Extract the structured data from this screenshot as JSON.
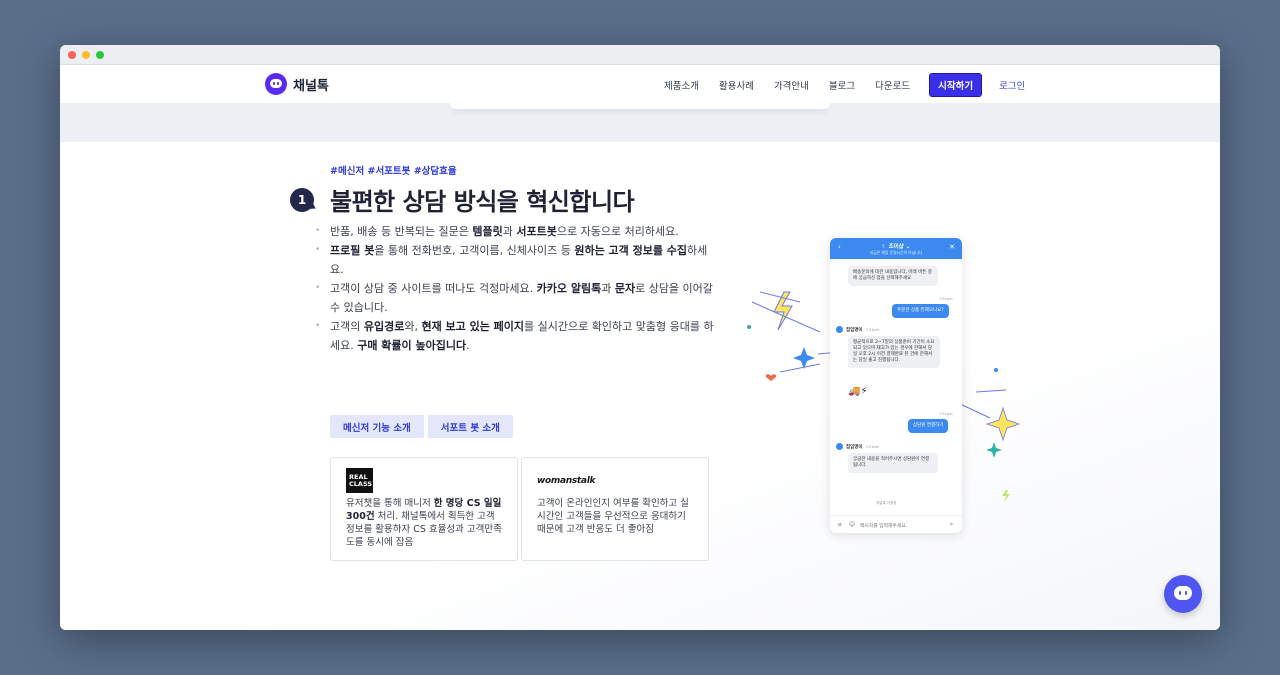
{
  "window": {
    "buttons": [
      "close",
      "minimize",
      "zoom"
    ]
  },
  "brand": {
    "name": "채널톡",
    "color": "#5a2bf0"
  },
  "nav": {
    "items": [
      "제품소개",
      "활용사례",
      "가격안내",
      "블로그",
      "다운로드"
    ],
    "start": "시작하기",
    "login": "로그인"
  },
  "section": {
    "tags": "#메신저 #서포트봇 #상담효율",
    "number": "1",
    "heading": "불편한 상담 방식을 혁신합니다",
    "bullets": [
      [
        "반품, 배송 등 반복되는 질문은 ",
        "템플릿",
        "과 ",
        "서포트봇",
        "으로 자동으로 처리하세요."
      ],
      [
        "",
        "프로필 봇",
        "을 통해 전화번호, 고객이름, 신체사이즈 등 ",
        "원하는 고객 정보를 수집",
        "하세요."
      ],
      [
        "고객이 상담 중 사이트를 떠나도 걱정마세요. ",
        "카카오 알림톡",
        "과 ",
        "문자",
        "로 상담을 이어갈 수 있습니다."
      ],
      [
        "고객의 ",
        "유입경로",
        "와, ",
        "현재 보고 있는 페이지",
        "를 실시간으로 확인하고 맞춤형 응대를 하세요. ",
        "구매 확률이 높아집니다",
        "."
      ]
    ],
    "buttons": [
      "메신저 기능 소개",
      "서포트 봇 소개"
    ]
  },
  "cases": [
    {
      "logo": "REAL CLASS",
      "text_parts": [
        "유저챗을 통해 매니저 ",
        "한 명당 CS 일일 300건",
        " 처리. 채널톡에서 획득한 고객 정보를 활용하자 CS 효율성과 고객만족도를 동시에 잡음"
      ]
    },
    {
      "logo": "womanstalk",
      "text": "고객이 온라인인지 여부를 확인하고 실시간인 고객들을 우선적으로 응대하기 때문에 고객 반응도 더 좋아짐"
    }
  ],
  "phone": {
    "title": "☾ 조이샵 ⌄",
    "subtitle": "지금은 채팅 운영시간이 아닙니다",
    "msg1": "배송문의에 대한 내용입니다. 아래 버튼 중에 궁금하신 점을 선택해주세요",
    "time1": "7:51pm",
    "user1": "주문한 상품 언제오나요?",
    "bot_name": "집입명이",
    "time2": "7:51pm",
    "msg2": "평균적으로 2~7일의 상품준비 기간이 소요되고 있으며 재고가 있는 경우에 한해서 당일 오후 2시 이전 결제완료 된 건에 한해서는 당일 출고 진행됩니다.",
    "emoji": "🚚⚡",
    "time3": "7:51pm",
    "user2": "상담원 연결하기",
    "time4": "7:51pm",
    "msg3": "궁금한 내용을 적어주시면 상담원이 연결됩니다.",
    "powered": "채널톡 이용중",
    "input_placeholder": "메시지를 입력해주세요."
  },
  "colors": {
    "accent": "#3b2ee8",
    "link": "#2f3bd6",
    "chat_blue": "#3c8af0",
    "fab": "#4f55f0"
  }
}
